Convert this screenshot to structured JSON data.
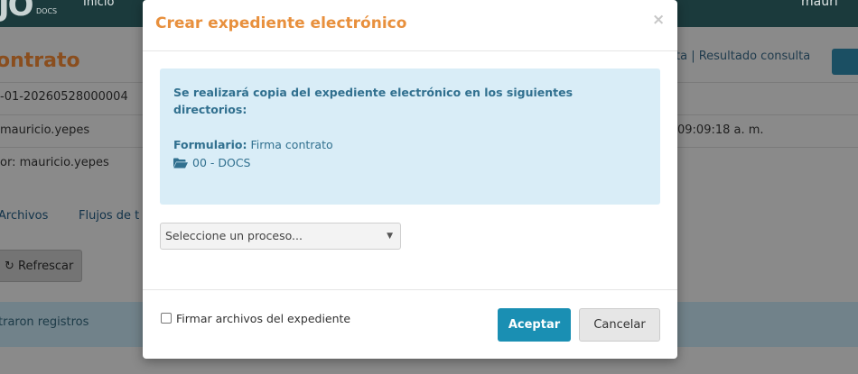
{
  "background": {
    "logo": "JO",
    "logo_sub": "DOCS",
    "nav_inicio": "Inicio",
    "user_name": "mauri",
    "page_title": "ontrato",
    "right_links": "ta | Resultado consulta",
    "rows": [
      "-01-20260528000004",
      "mauricio.yepes",
      "or: mauricio.yepes"
    ],
    "row_date": "09:09:18 a. m.",
    "tabs": [
      "Archivos",
      "Flujos de t"
    ],
    "refresh_label": "Refrescar",
    "empty_message": "traron registros"
  },
  "modal": {
    "title": "Crear expediente electrónico",
    "close_symbol": "×",
    "alert": {
      "message": "Se realizará copia del expediente electrónico en los siguientes directorios:",
      "form_label": "Formulario:",
      "form_value": "Firma contrato",
      "folder": "00 - DOCS"
    },
    "select": {
      "value": "Seleccione un proceso..."
    },
    "footer": {
      "checkbox_label": "Firmar archivos del expediente",
      "checkbox_checked": false,
      "accept_label": "Aceptar",
      "cancel_label": "Cancelar"
    }
  },
  "colors": {
    "title": "#e8903d",
    "alert_bg": "#d9edf7",
    "alert_text": "#31708f",
    "primary_button": "#1a8fb3"
  },
  "icons": {
    "folder": "folder-open-icon",
    "refresh": "refresh-icon",
    "select_caret": "caret-down-icon"
  }
}
